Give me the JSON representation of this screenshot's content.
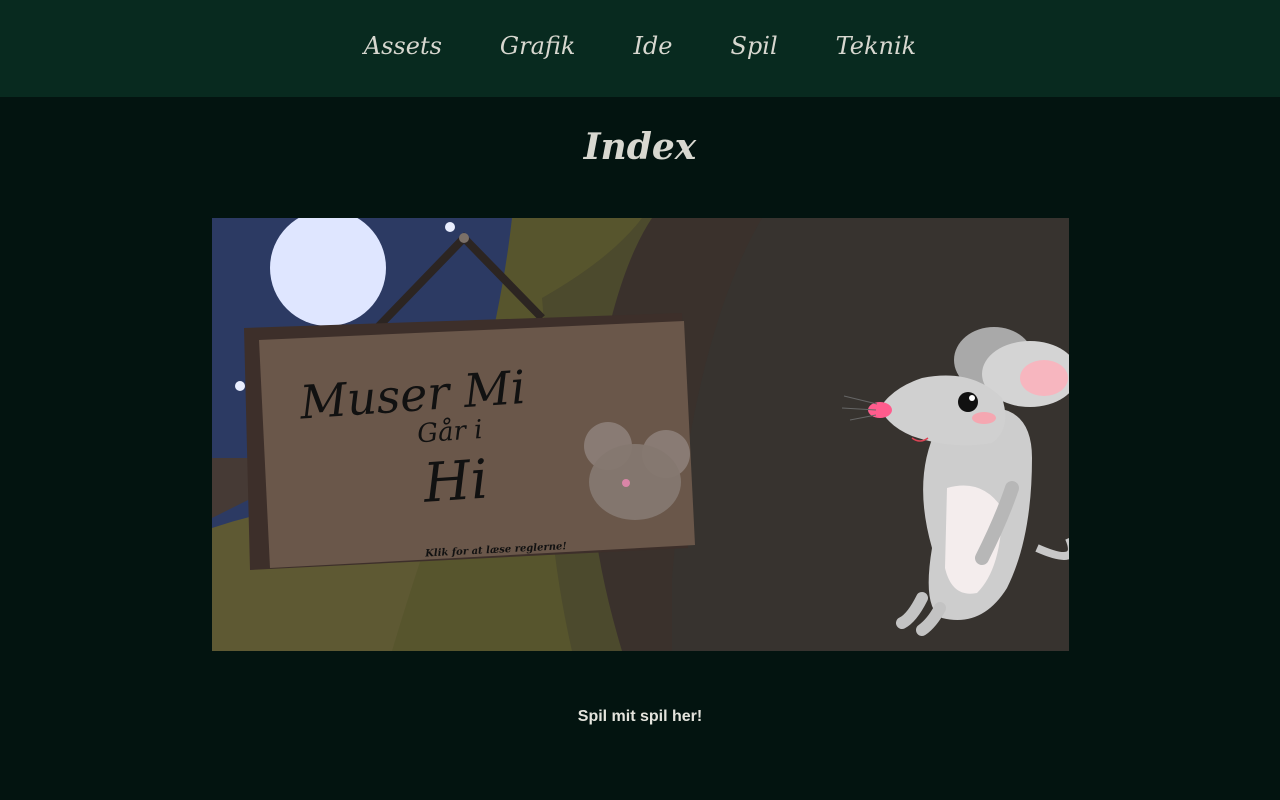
{
  "nav": {
    "items": [
      {
        "label": "Assets"
      },
      {
        "label": "Grafik"
      },
      {
        "label": "Ide"
      },
      {
        "label": "Spil"
      },
      {
        "label": "Teknik"
      }
    ]
  },
  "page": {
    "title": "Index"
  },
  "game": {
    "sign_title_line1": "Muser Mi",
    "sign_title_line2": "Går i",
    "sign_title_line3": "Hi",
    "sign_caption": "Klik for at læse reglerne!"
  },
  "footer": {
    "play_text": "Spil mit spil her!"
  },
  "colors": {
    "nav_bg": "#082a1f",
    "page_bg": "#031410",
    "sky": "#2c3a63",
    "moon": "#dfe6ff",
    "sign_wood": "#6a574a",
    "cave": "#3a3430",
    "mouse_body": "#c8c8c8"
  }
}
